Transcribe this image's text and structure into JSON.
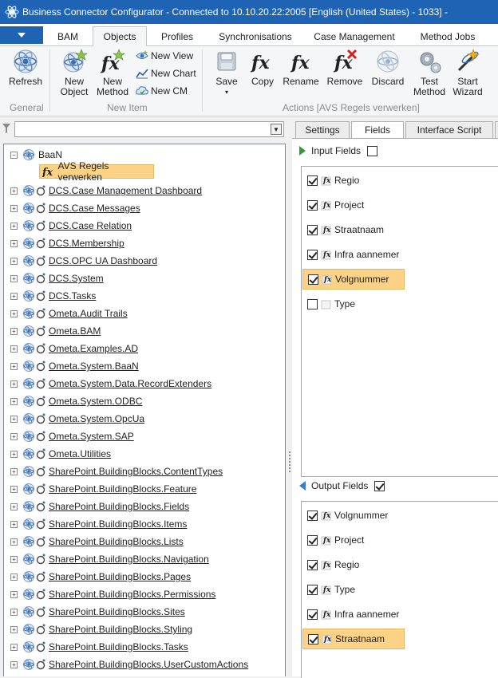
{
  "window": {
    "title": "Business Connector Configurator - Connected to 10.10.20.22:2005 [English (United States) - 1033] -"
  },
  "ribbon": {
    "tabs": [
      "BAM",
      "Objects",
      "Profiles",
      "Synchronisations",
      "Case Management",
      "Method Jobs"
    ],
    "active_tab": "Objects",
    "groups": {
      "general": {
        "label": "General",
        "refresh": "Refresh"
      },
      "new_item": {
        "label": "New Item",
        "new_object": "New Object",
        "new_method": "New Method",
        "new_view": "New View",
        "new_chart": "New Chart",
        "new_cm": "New CM"
      },
      "actions": {
        "label": "Actions [AVS Regels verwerken]",
        "save": "Save",
        "copy": "Copy",
        "rename": "Rename",
        "remove": "Remove",
        "discard": "Discard",
        "test_method": "Test Method",
        "start_wizard": "Start Wizard"
      }
    }
  },
  "filter": {
    "value": ""
  },
  "tree": {
    "root": "BaaN",
    "selected_method": "AVS Regels verwerken",
    "items": [
      "DCS.Case Management Dashboard",
      "DCS.Case Messages",
      "DCS.Case Relation",
      "DCS.Membership",
      "DCS.OPC UA Dashboard",
      "DCS.System",
      "DCS.Tasks",
      "Ometa.Audit Trails",
      "Ometa.BAM",
      "Ometa.Examples.AD",
      "Ometa.System.BaaN",
      "Ometa.System.Data.RecordExtenders",
      "Ometa.System.ODBC",
      "Ometa.System.OpcUa",
      "Ometa.System.SAP",
      "Ometa.Utilities",
      "SharePoint.BuildingBlocks.ContentTypes",
      "SharePoint.BuildingBlocks.Feature",
      "SharePoint.BuildingBlocks.Fields",
      "SharePoint.BuildingBlocks.Items",
      "SharePoint.BuildingBlocks.Lists",
      "SharePoint.BuildingBlocks.Navigation",
      "SharePoint.BuildingBlocks.Pages",
      "SharePoint.BuildingBlocks.Permissions",
      "SharePoint.BuildingBlocks.Sites",
      "SharePoint.BuildingBlocks.Styling",
      "SharePoint.BuildingBlocks.Tasks",
      "SharePoint.BuildingBlocks.UserCustomActions"
    ]
  },
  "detail_tabs": {
    "items": [
      "Settings",
      "Fields",
      "Interface Script"
    ],
    "active": "Fields"
  },
  "input_fields": {
    "label": "Input Fields",
    "header_checked": false,
    "items": [
      {
        "name": "Regio",
        "checked": true,
        "selected": false,
        "icon": "fx-field-icon"
      },
      {
        "name": "Project",
        "checked": true,
        "selected": false,
        "icon": "fx-field-icon"
      },
      {
        "name": "Straatnaam",
        "checked": true,
        "selected": false,
        "icon": "fx-field-icon"
      },
      {
        "name": "Infra aannemer",
        "checked": true,
        "selected": false,
        "icon": "fx-field-icon"
      },
      {
        "name": "Volgnummer",
        "checked": true,
        "selected": true,
        "icon": "fx-field-icon"
      },
      {
        "name": "Type",
        "checked": false,
        "selected": false,
        "icon": "field-icon"
      }
    ]
  },
  "output_fields": {
    "label": "Output Fields",
    "header_checked": true,
    "items": [
      {
        "name": "Volgnummer",
        "checked": true,
        "selected": false
      },
      {
        "name": "Project",
        "checked": true,
        "selected": false
      },
      {
        "name": "Regio",
        "checked": true,
        "selected": false
      },
      {
        "name": "Type",
        "checked": true,
        "selected": false
      },
      {
        "name": "Infra aannemer",
        "checked": true,
        "selected": false
      },
      {
        "name": "Straatnaam",
        "checked": true,
        "selected": true
      }
    ]
  },
  "colors": {
    "accent": "#1e63b4",
    "selection": "#fbd286",
    "arrow_green": "#2e9e2e",
    "arrow_blue": "#3b7bd0"
  }
}
